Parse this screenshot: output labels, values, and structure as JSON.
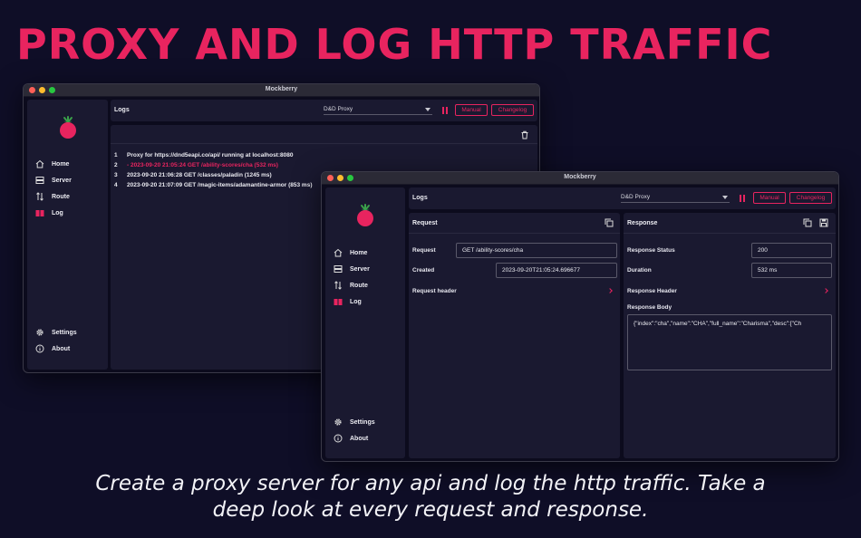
{
  "headline": "PROXY AND LOG HTTP TRAFFIC",
  "caption_line1": "Create a proxy server for any api and log the http traffic. Take a",
  "caption_line2": "deep look at every request and response.",
  "colors": {
    "accent": "#e8245f",
    "background": "#0f0e27",
    "panel": "#1a1930"
  },
  "window_back": {
    "title": "Mockberry",
    "sidebar": {
      "nav": [
        {
          "label": "Home",
          "icon": "home-icon"
        },
        {
          "label": "Server",
          "icon": "server-icon"
        },
        {
          "label": "Route",
          "icon": "route-icon"
        },
        {
          "label": "Log",
          "icon": "log-icon",
          "active": true
        }
      ],
      "footer": [
        {
          "label": "Settings",
          "icon": "gear-icon"
        },
        {
          "label": "About",
          "icon": "info-icon"
        }
      ]
    },
    "topbar": {
      "title": "Logs",
      "proxy_select": "D&D Proxy",
      "manual": "Manual",
      "changelog": "Changelog"
    },
    "logs": [
      {
        "num": "1",
        "text": "Proxy for https://dnd5eapi.co/api/ running at localhost:8080"
      },
      {
        "num": "2",
        "text": "- 2023-09-20 21:05:24 GET /ability-scores/cha (532 ms)",
        "selected": true
      },
      {
        "num": "3",
        "text": "2023-09-20 21:06:28 GET /classes/paladin (1245 ms)"
      },
      {
        "num": "4",
        "text": "2023-09-20 21:07:09 GET /magic-items/adamantine-armor (853 ms)"
      }
    ]
  },
  "window_front": {
    "title": "Mockberry",
    "sidebar": {
      "nav": [
        {
          "label": "Home",
          "icon": "home-icon"
        },
        {
          "label": "Server",
          "icon": "server-icon"
        },
        {
          "label": "Route",
          "icon": "route-icon"
        },
        {
          "label": "Log",
          "icon": "log-icon",
          "active": true
        }
      ],
      "footer": [
        {
          "label": "Settings",
          "icon": "gear-icon"
        },
        {
          "label": "About",
          "icon": "info-icon"
        }
      ]
    },
    "topbar": {
      "title": "Logs",
      "proxy_select": "D&D Proxy",
      "manual": "Manual",
      "changelog": "Changelog"
    },
    "request": {
      "title": "Request",
      "request_label": "Request",
      "request_value": "GET /ability-scores/cha",
      "created_label": "Created",
      "created_value": "2023-09-20T21:05:24.696677",
      "header_label": "Request header"
    },
    "response": {
      "title": "Response",
      "status_label": "Response Status",
      "status_value": "200",
      "duration_label": "Duration",
      "duration_value": "532 ms",
      "header_label": "Response Header",
      "body_label": "Response Body",
      "body_value": "{\"index\":\"cha\",\"name\":\"CHA\",\"full_name\":\"Charisma\",\"desc\":[\"Ch"
    }
  }
}
